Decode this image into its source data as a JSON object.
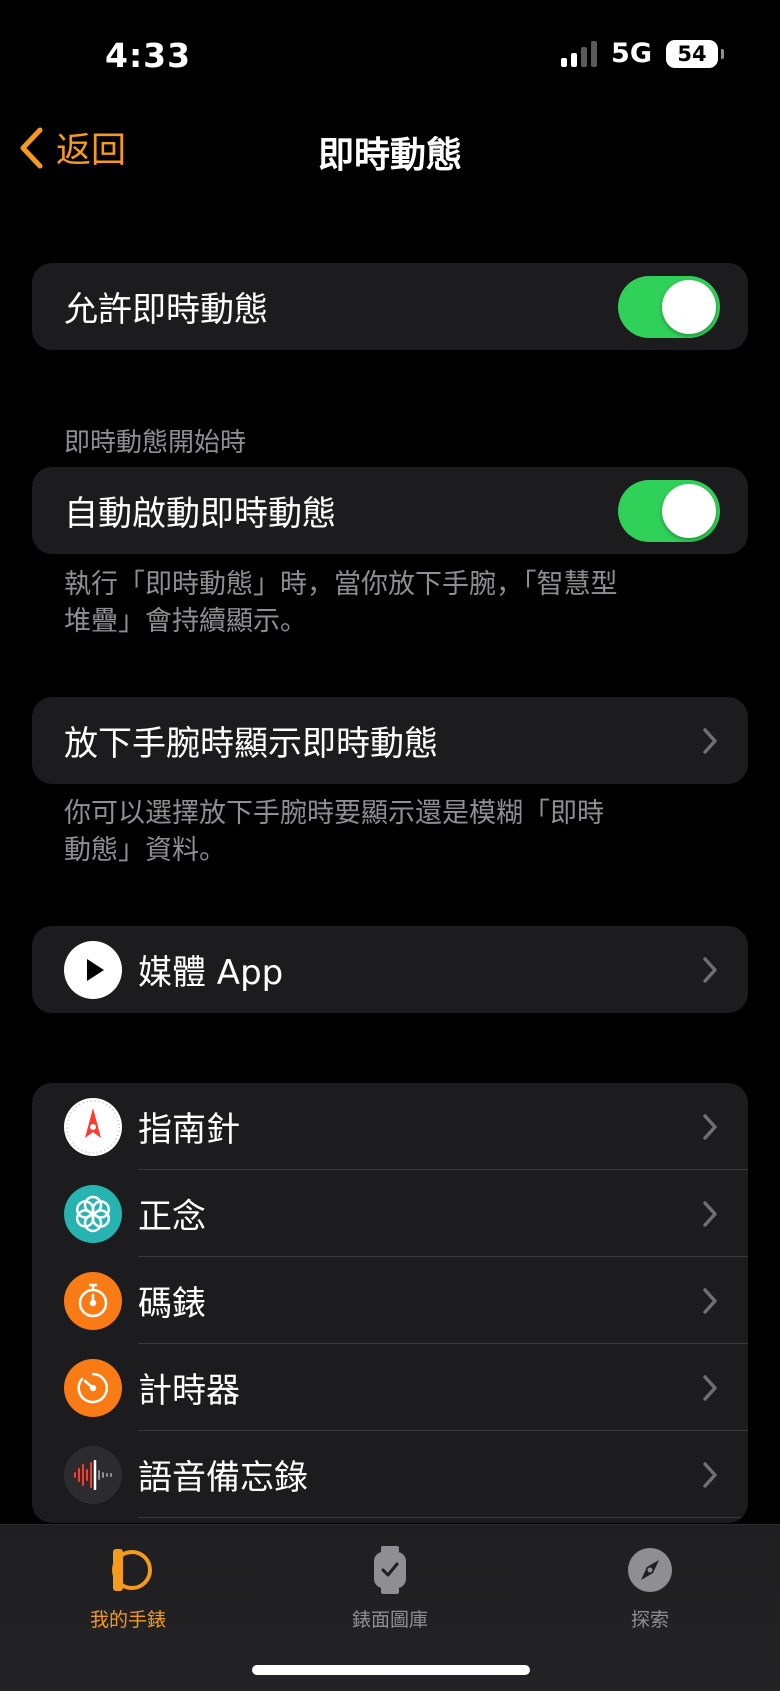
{
  "status_bar": {
    "time": "4:33",
    "network": "5G",
    "battery": "54"
  },
  "nav": {
    "back_label": "返回",
    "title": "即時動態"
  },
  "allow_group": {
    "label": "允許即時動態",
    "enabled": true
  },
  "auto_section": {
    "header": "即時動態開始時",
    "label": "自動啟動即時動態",
    "enabled": true,
    "footer_line1": "執行「即時動態」時，當你放下手腕，「智慧型",
    "footer_line2": "堆疊」會持續顯示。"
  },
  "wrist_down": {
    "label": "放下手腕時顯示即時動態",
    "footer_line1": "你可以選擇放下手腕時要顯示還是模糊「即時",
    "footer_line2": "動態」資料。"
  },
  "media": {
    "label": "媒體 App",
    "icon": "play-icon"
  },
  "apps": [
    {
      "label": "指南針",
      "icon": "compass-icon"
    },
    {
      "label": "正念",
      "icon": "mindfulness-icon"
    },
    {
      "label": "碼錶",
      "icon": "stopwatch-icon"
    },
    {
      "label": "計時器",
      "icon": "timer-icon"
    },
    {
      "label": "語音備忘錄",
      "icon": "voice-memo-icon"
    }
  ],
  "tab_bar": {
    "tabs": [
      {
        "label": "我的手錶",
        "icon": "watch-icon",
        "active": true
      },
      {
        "label": "錶面圖庫",
        "icon": "watch-face-icon",
        "active": false
      },
      {
        "label": "探索",
        "icon": "discover-icon",
        "active": false
      }
    ]
  },
  "colors": {
    "accent": "#f49a1e",
    "toggle_on": "#30d158",
    "cell_bg": "#1c1c1e",
    "secondary_text": "#8e8e93"
  }
}
